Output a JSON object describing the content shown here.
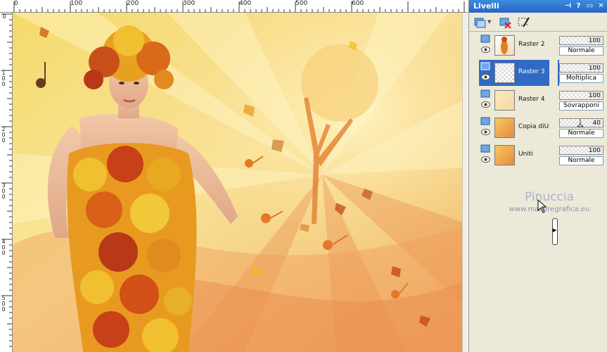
{
  "ruler": {
    "top_labels": [
      "0",
      "100",
      "200",
      "300",
      "400",
      "500",
      "600"
    ],
    "left_labels": [
      "0",
      "1 0 0",
      "2 0 0",
      "3 0 0",
      "4 0 0",
      "5 0 0"
    ]
  },
  "panel": {
    "title": "Livelli",
    "title_controls": [
      "pin-icon",
      "help-icon",
      "minimize-icon",
      "close-icon"
    ]
  },
  "layers": [
    {
      "name": "Raster 2",
      "selected": false,
      "opacity": "100",
      "blend": "Normale",
      "thumb": "leaf-figure"
    },
    {
      "name": "Raster 3",
      "selected": true,
      "opacity": "100",
      "blend": "Moltiplica",
      "thumb": "transparent"
    },
    {
      "name": "Raster 4",
      "selected": false,
      "opacity": "100",
      "blend": "Sovrapponi",
      "thumb": "light-pattern"
    },
    {
      "name": "Copia diUni",
      "selected": false,
      "opacity": "40",
      "blend": "Normale",
      "thumb": "autumn-scene"
    },
    {
      "name": "Uniti",
      "selected": false,
      "opacity": "100",
      "blend": "Normale",
      "thumb": "autumn-scene"
    }
  ],
  "watermark": {
    "title": "Pinuccia",
    "url": "www.maidiregrafica.eu"
  },
  "colors": {
    "selection": "#316ac5",
    "titlebar": "#2a63c6",
    "panel_bg": "#ece9d8"
  }
}
